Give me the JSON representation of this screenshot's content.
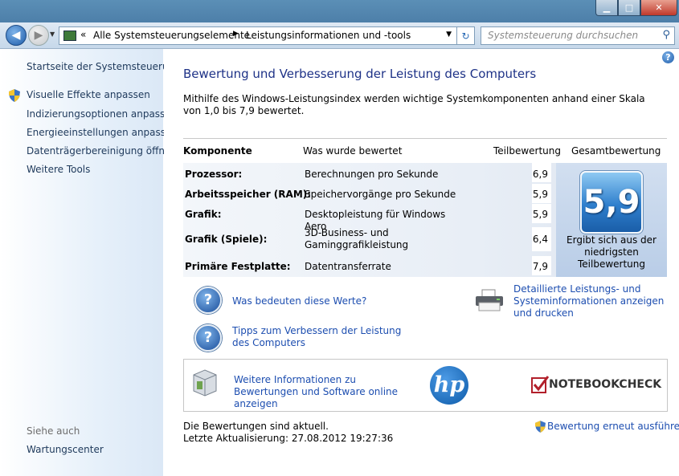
{
  "window": {
    "address": {
      "crumbs": [
        "Alle Systemsteuerungselemente",
        "Leistungsinformationen und -tools"
      ]
    },
    "search": {
      "placeholder": "Systemsteuerung durchsuchen"
    }
  },
  "sidebar": {
    "home": "Startseite der Systemsteuerung",
    "tasks": [
      "Visuelle Effekte anpassen",
      "Indizierungsoptionen anpassen",
      "Energieeinstellungen anpassen",
      "Datenträgerbereinigung öffnen",
      "Weitere Tools"
    ],
    "see_also_title": "Siehe auch",
    "see_also_links": [
      "Wartungscenter"
    ]
  },
  "main": {
    "title": "Bewertung und Verbesserung der Leistung des Computers",
    "intro": "Mithilfe des Windows-Leistungsindex werden wichtige Systemkomponenten anhand einer Skala von 1,0 bis 7,9 bewertet.",
    "table": {
      "headers": {
        "component": "Komponente",
        "rated": "Was wurde bewertet",
        "subscore": "Teilbewertung",
        "basescore": "Gesamtbewertung"
      },
      "rows": [
        {
          "component": "Prozessor:",
          "rated": "Berechnungen pro Sekunde",
          "score": "6,9"
        },
        {
          "component": "Arbeitsspeicher (RAM):",
          "rated": "Speichervorgänge pro Sekunde",
          "score": "5,9"
        },
        {
          "component": "Grafik:",
          "rated": "Desktopleistung für Windows Aero",
          "score": "5,9"
        },
        {
          "component": "Grafik (Spiele):",
          "rated": "3D-Business- und Gaminggrafikleistung",
          "score": "6,4"
        },
        {
          "component": "Primäre Festplatte:",
          "rated": "Datentransferrate",
          "score": "7,9"
        }
      ],
      "base_score": "5,9",
      "base_caption": "Ergibt sich aus der niedrigsten Teilbewertung"
    },
    "links": {
      "what_mean": "Was bedeuten diese Werte?",
      "tips": "Tipps zum Verbessern der Leistung des Computers",
      "details": "Detaillierte Leistungs- und Systeminformationen anzeigen und drucken"
    },
    "online_box": {
      "link": "Weitere Informationen zu Bewertungen und Software online anzeigen",
      "hp_logo": "hp",
      "watermark": "NOTEBOOKCHECK"
    },
    "status": {
      "current": "Die Bewertungen sind aktuell.",
      "last_update": "Letzte Aktualisierung: 27.08.2012 19:27:36"
    },
    "rerun_label": "Bewertung erneut ausführen"
  }
}
